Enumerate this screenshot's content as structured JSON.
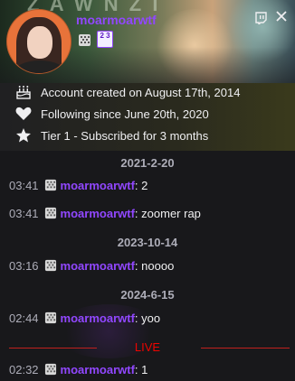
{
  "banner": {
    "text": "Z A W N Z I"
  },
  "profile": {
    "username": "moarmoarwtf",
    "badges": [
      "subscriber-badge",
      "year-badge"
    ],
    "year_badge": "2 3"
  },
  "header": {
    "twitch_icon": "twitch-logo-icon",
    "close_icon": "close-icon"
  },
  "info": {
    "items": [
      {
        "icon": "cake-icon",
        "text": "Account created on August 17th, 2014"
      },
      {
        "icon": "heart-icon",
        "text": "Following since June 20th, 2020"
      },
      {
        "icon": "star-icon",
        "text": "Tier 1 - Subscribed for 3 months"
      }
    ]
  },
  "chat": {
    "dates": [
      "2021-2-20",
      "2023-10-14",
      "2024-6-15"
    ],
    "messages": [
      {
        "time": "03:41",
        "user": "moarmoarwtf",
        "sep": ":",
        "text": "2"
      },
      {
        "time": "03:41",
        "user": "moarmoarwtf",
        "sep": ":",
        "text": "zoomer rap"
      },
      {
        "time": "03:16",
        "user": "moarmoarwtf",
        "sep": ":",
        "text": "noooo"
      },
      {
        "time": "02:44",
        "user": "moarmoarwtf",
        "sep": ":",
        "text": "yoo"
      },
      {
        "time": "02:32",
        "user": "moarmoarwtf",
        "sep": ":",
        "text": "1"
      }
    ],
    "live_label": "LIVE"
  },
  "colors": {
    "accent": "#9147ff",
    "avatar_bg": "#e8733a",
    "live": "#eb0400"
  }
}
